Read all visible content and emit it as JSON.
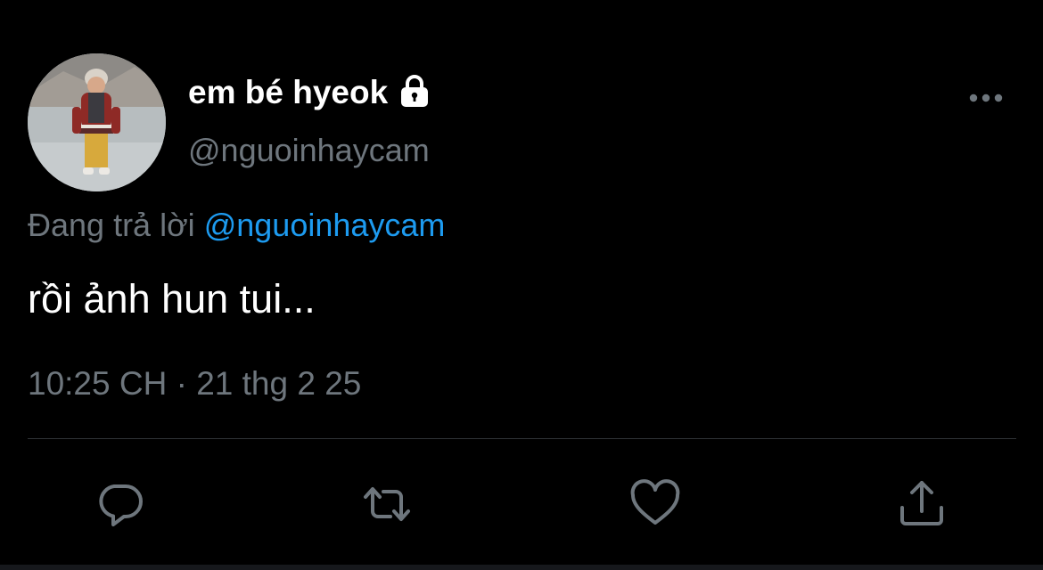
{
  "tweet": {
    "display_name": "em bé hyeok",
    "handle": "@nguoinhaycam",
    "reply_prefix": "Đang trả lời",
    "reply_mention": "@nguoinhaycam",
    "text": "rồi ảnh hun tui...",
    "timestamp": "10:25 CH · 21 thg 2 25",
    "protected": true
  },
  "icons": {
    "lock": "lock-icon",
    "more": "more-options-icon",
    "reply": "reply-icon",
    "retweet": "retweet-icon",
    "like": "heart-icon",
    "share": "share-icon"
  },
  "colors": {
    "background": "#000000",
    "primary_text": "#ffffff",
    "secondary_text": "#6e767d",
    "accent": "#1d9bf0",
    "divider": "#2f3336"
  }
}
